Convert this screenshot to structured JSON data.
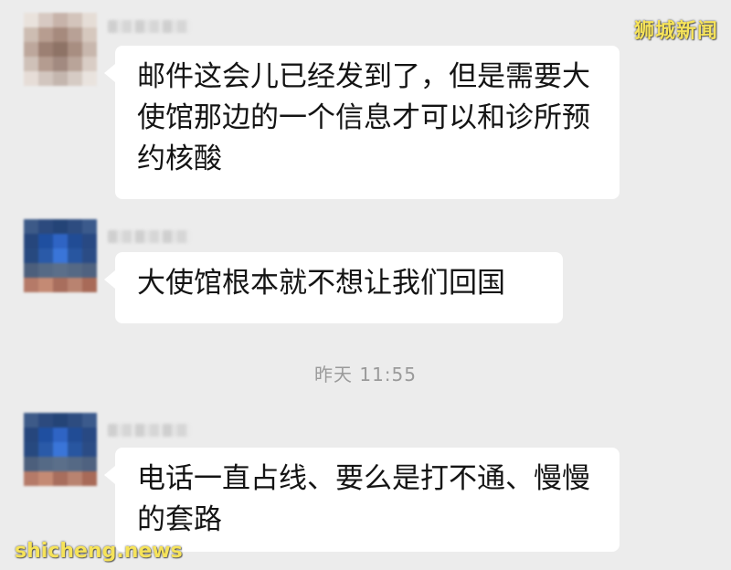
{
  "watermarks": {
    "top_right": "狮城新闻",
    "bottom_left": "shicheng.news"
  },
  "messages": [
    {
      "text": "邮件这会儿已经发到了，但是需要大使馆那边的一个信息才可以和诊所预约核酸"
    },
    {
      "text": "大使馆根本就不想让我们回国"
    },
    {
      "text": "电话一直占线、要么是打不通、慢慢的套路"
    }
  ],
  "timestamp": "昨天 11:55",
  "colors": {
    "background": "#ececec",
    "bubble": "#ffffff",
    "timestamp": "#9a9a9a",
    "watermark": "#f6e35a"
  }
}
